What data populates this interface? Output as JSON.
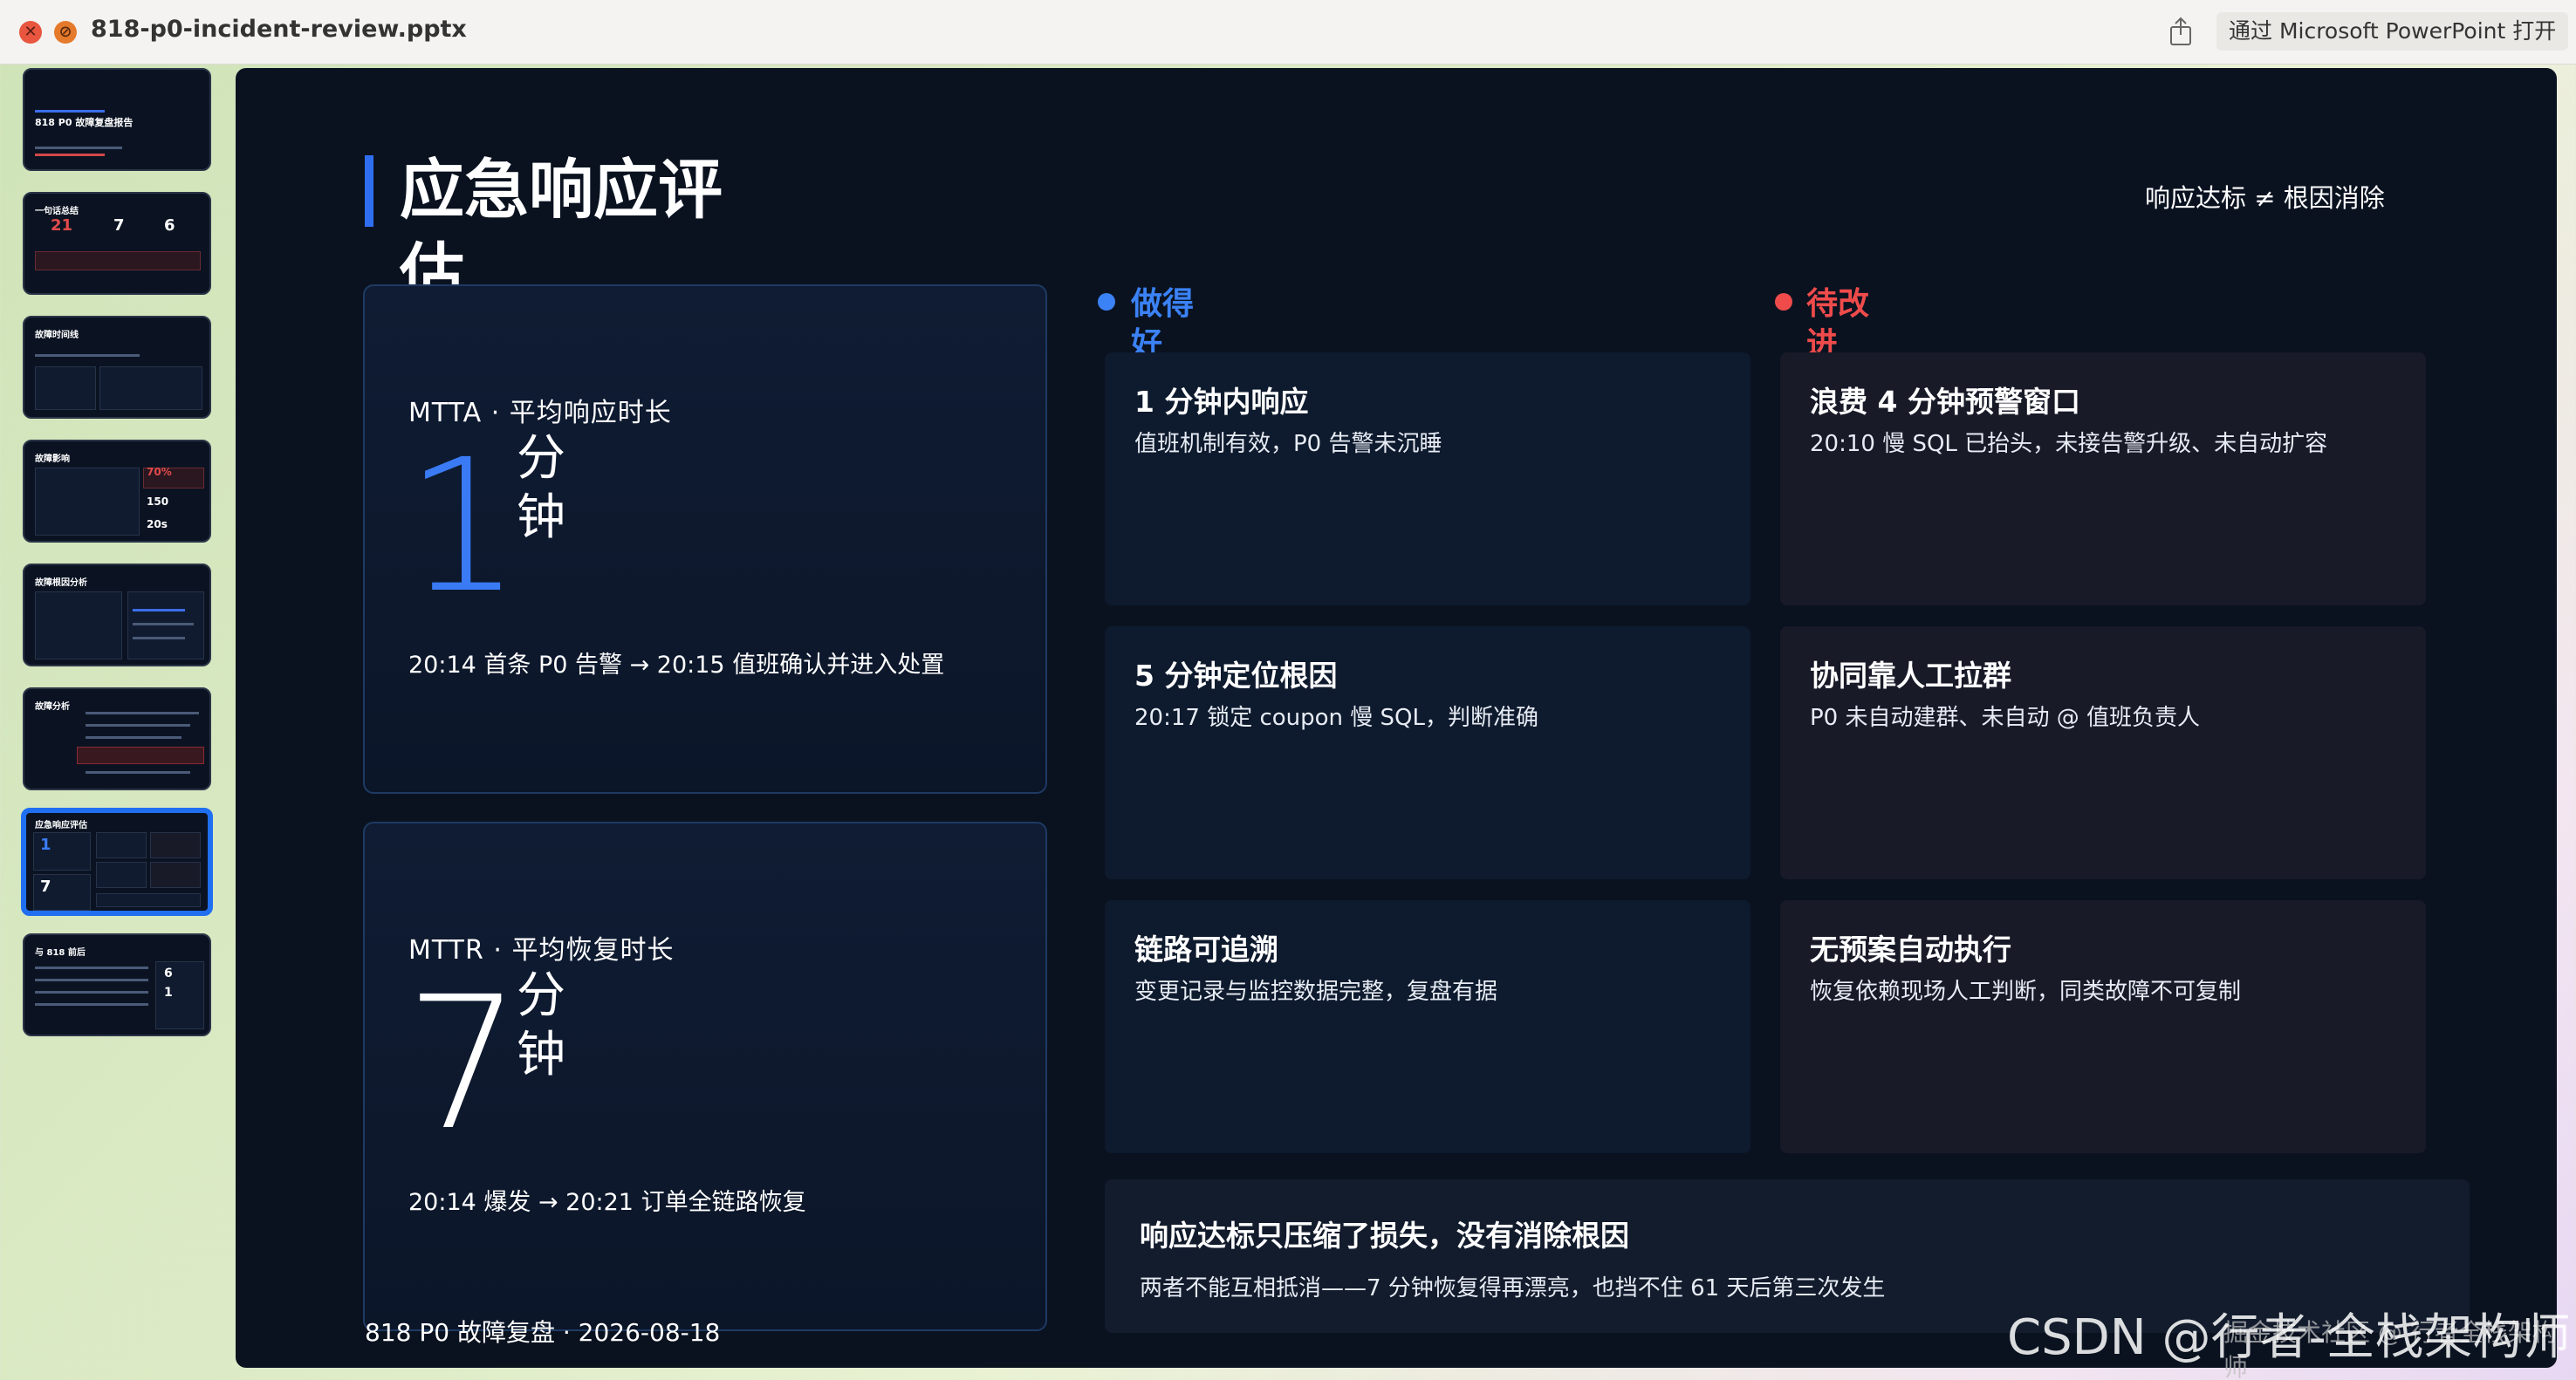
{
  "window": {
    "filename": "818-p0-incident-review.pptx",
    "open_button": "通过 Microsoft PowerPoint 打开",
    "icons": {
      "close": "close-icon",
      "disabled": "nosign-icon",
      "share": "share-icon"
    }
  },
  "thumbnails": [
    {
      "title": "818 P0 故障复盘报告",
      "active": false
    },
    {
      "title": "一句话总结",
      "nums": [
        "21",
        "7",
        "6"
      ],
      "active": false
    },
    {
      "title": "故障时间线",
      "active": false
    },
    {
      "title": "故障影响",
      "nums": [
        "70%",
        "150",
        "20s"
      ],
      "active": false
    },
    {
      "title": "故障根因分析",
      "active": false
    },
    {
      "title": "故障分析",
      "active": false
    },
    {
      "title": "应急响应评估",
      "nums": [
        "1",
        "7"
      ],
      "active": true
    },
    {
      "title": "与 818 前后",
      "nums": [
        "6",
        "1"
      ],
      "active": false
    }
  ],
  "slide": {
    "title": "应急响应评估",
    "tag": "响应达标 ≠ 根因消除",
    "mtta": {
      "label": "MTTA · 平均响应时长",
      "value": "1",
      "unit": "分钟",
      "desc": "20:14 首条 P0 告警 → 20:15 值班确认并进入处置"
    },
    "mttr": {
      "label": "MTTR · 平均恢复时长",
      "value": "7",
      "unit": "分钟",
      "desc": "20:14 爆发 → 20:21 订单全链路恢复"
    },
    "good": {
      "heading": "做得好",
      "items": [
        {
          "title": "1 分钟内响应",
          "desc": "值班机制有效，P0 告警未沉睡"
        },
        {
          "title": "5 分钟定位根因",
          "desc": "20:17 锁定 coupon 慢 SQL，判断准确"
        },
        {
          "title": "链路可追溯",
          "desc": "变更记录与监控数据完整，复盘有据"
        }
      ]
    },
    "bad": {
      "heading": "待改进",
      "items": [
        {
          "title": "浪费 4 分钟预警窗口",
          "desc": "20:10 慢 SQL 已抬头，未接告警升级、未自动扩容"
        },
        {
          "title": "协同靠人工拉群",
          "desc": "P0 未自动建群、未自动 @ 值班负责人"
        },
        {
          "title": "无预案自动执行",
          "desc": "恢复依赖现场人工判断，同类故障不可复制"
        }
      ]
    },
    "conclusion": {
      "title": "响应达标只压缩了损失，没有消除根因",
      "desc": "两者不能互相抵消——7 分钟恢复得再漂亮，也挡不住 61 天后第三次发生"
    },
    "footer": "818 P0 故障复盘 · 2026-08-18"
  },
  "colors": {
    "accent_blue": "#2f6ef0",
    "metric_blue": "#3a7bf5",
    "good_blue": "#3b82f6",
    "bad_red": "#ef4b4b",
    "slide_bg": "#0a1220"
  },
  "watermark": {
    "main": "CSDN @行者-全栈架构师",
    "small": "掘金技术社区 @ 行者全栈架构师"
  }
}
